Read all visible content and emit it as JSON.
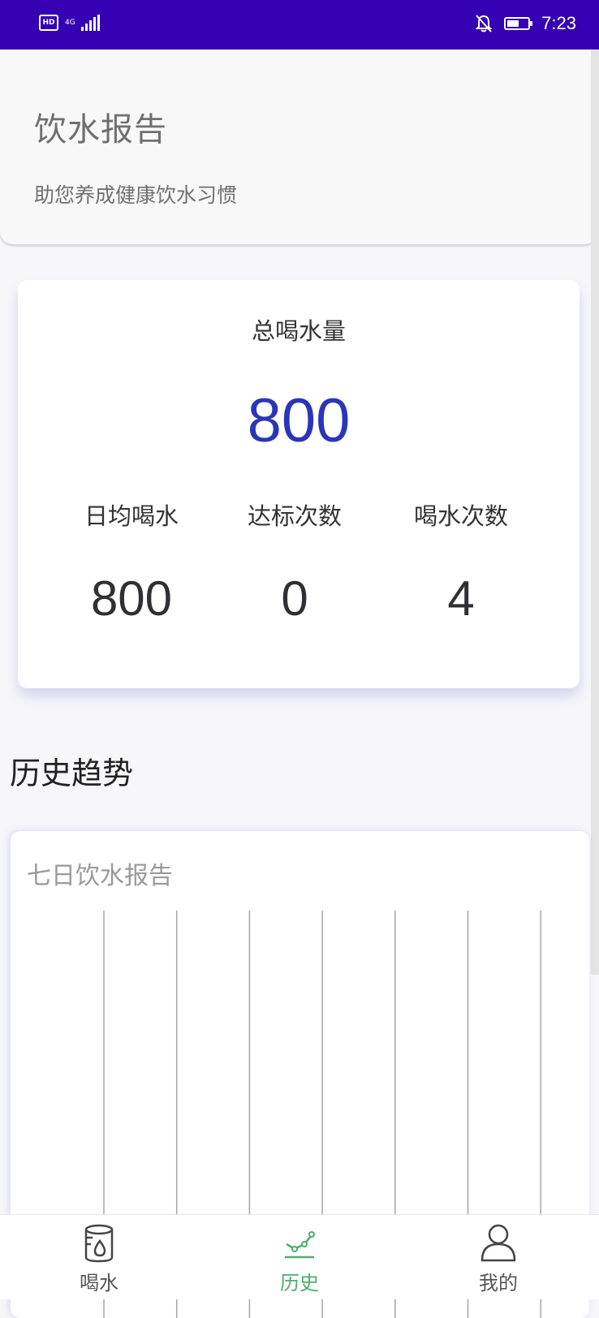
{
  "status_bar": {
    "hd_label": "HD",
    "network_label": "4G",
    "time": "7:23"
  },
  "header": {
    "title": "饮水报告",
    "subtitle": "助您养成健康饮水习惯"
  },
  "stats": {
    "total_label": "总喝水量",
    "total_value": "800",
    "items": [
      {
        "label": "日均喝水",
        "value": "800"
      },
      {
        "label": "达标次数",
        "value": "0"
      },
      {
        "label": "喝水次数",
        "value": "4"
      }
    ]
  },
  "history": {
    "section_title": "历史趋势",
    "chart_title": "七日饮水报告"
  },
  "nav": {
    "items": [
      {
        "label": "喝水",
        "icon": "water-cup-icon",
        "active": false
      },
      {
        "label": "历史",
        "icon": "chart-line-icon",
        "active": true
      },
      {
        "label": "我的",
        "icon": "user-icon",
        "active": false
      }
    ]
  },
  "colors": {
    "status_bar": "#3600b3",
    "accent_blue": "#2a36b8",
    "active_green": "#4cae6e"
  },
  "chart_data": {
    "type": "bar",
    "title": "七日饮水报告",
    "categories": [],
    "values": [],
    "gridlines": 7,
    "grid": true
  }
}
